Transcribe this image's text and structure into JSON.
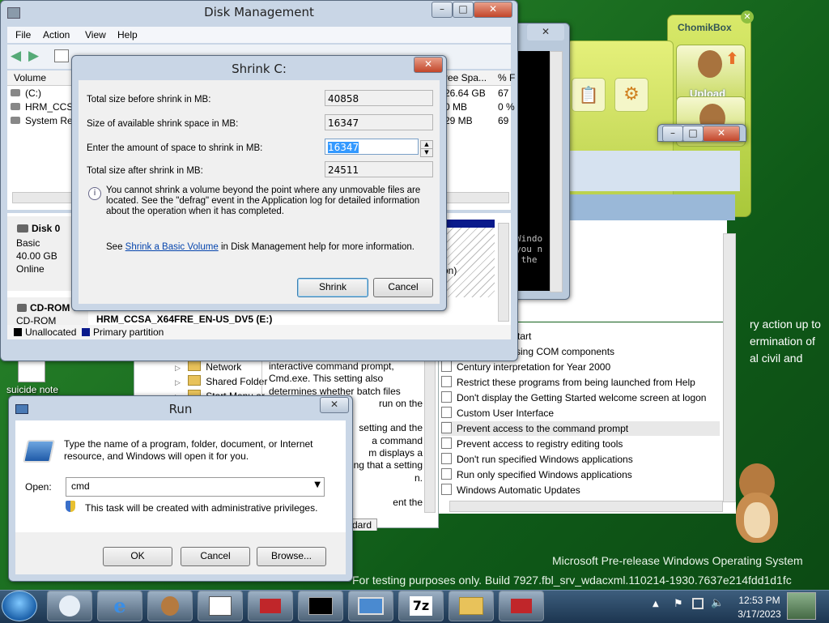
{
  "disk_mgmt": {
    "title": "Disk Management",
    "menu": [
      "File",
      "Action",
      "View",
      "Help"
    ],
    "columns": [
      "Volume",
      "ree Spa...",
      "% F"
    ],
    "volumes": [
      {
        "name": "(C:)",
        "free": "26.64 GB",
        "pct": "67"
      },
      {
        "name": "HRM_CCSA_",
        "free": "0 MB",
        "pct": "0 %"
      },
      {
        "name": "System Rese",
        "free": "29 MB",
        "pct": "69"
      }
    ],
    "disk0": {
      "name": "Disk 0",
      "type": "Basic",
      "size": "40.00 GB",
      "status": "Online"
    },
    "cdrom": {
      "name": "CD-ROM 0",
      "type": "CD-ROM",
      "volume_label": "HRM_CCSA_X64FRE_EN-US_DV5 (E:)"
    },
    "partition_text": "tion)",
    "legend": [
      "Unallocated",
      "Primary partition"
    ]
  },
  "shrink": {
    "title": "Shrink C:",
    "rows": [
      {
        "label": "Total size before shrink in MB:",
        "value": "40858"
      },
      {
        "label": "Size of available shrink space in MB:",
        "value": "16347"
      },
      {
        "label": "Enter the amount of space to shrink in MB:",
        "value": "16347"
      },
      {
        "label": "Total size after shrink in MB:",
        "value": "24511"
      }
    ],
    "info": "You cannot shrink a volume beyond the point where any unmovable files are located. See the \"defrag\" event in the Application log for detailed information about the operation when it has completed.",
    "help_prefix": "See",
    "help_link": "Shrink a Basic Volume",
    "help_suffix": "in Disk Management help for more information.",
    "ok": "Shrink",
    "cancel": "Cancel"
  },
  "cmd": {
    "lines": [
      "Windo",
      "you n",
      " the"
    ]
  },
  "chomikbox": {
    "title": "ChomikBox",
    "upload": "Upload"
  },
  "gpedit": {
    "side_text": "ry action up to\nermination of\nal civil and",
    "items": [
      "Start",
      "ssing COM components",
      "Century interpretation for Year 2000",
      "Restrict these programs from being launched from Help",
      "Don't display the Getting Started welcome screen at logon",
      "Custom User Interface",
      "Prevent access to the command prompt",
      "Prevent access to registry editing tools",
      "Don't run specified Windows applications",
      "Run only specified Windows applications",
      "Windows Automatic Updates"
    ],
    "selected_index": 6,
    "tab": "dard",
    "desc_lines": [
      "interactive command prompt,",
      "Cmd.exe. This setting also",
      "determines whether batch files",
      "run on the",
      "",
      "setting and the",
      "a command",
      "m displays a",
      "ing that a setting",
      "n.",
      "",
      "ent the"
    ]
  },
  "explorer": {
    "items": [
      "Network",
      "Shared Folder",
      "Start Menu ar"
    ]
  },
  "desktop": {
    "note_label": "suicide note",
    "watermark1": "Microsoft Pre-release Windows Operating System",
    "watermark2": "For testing purposes only. Build 7927.fbl_srv_wdacxml.110214-1930.7637e214fdd1d1fc"
  },
  "run": {
    "title": "Run",
    "desc": "Type the name of a program, folder, document, or Internet resource, and Windows will open it for you.",
    "open_label": "Open:",
    "open_value": "cmd",
    "admin_note": "This task will be created with administrative privileges.",
    "ok": "OK",
    "cancel": "Cancel",
    "browse": "Browse..."
  },
  "taskbar": {
    "time": "12:53 PM",
    "date": "3/17/2023"
  }
}
